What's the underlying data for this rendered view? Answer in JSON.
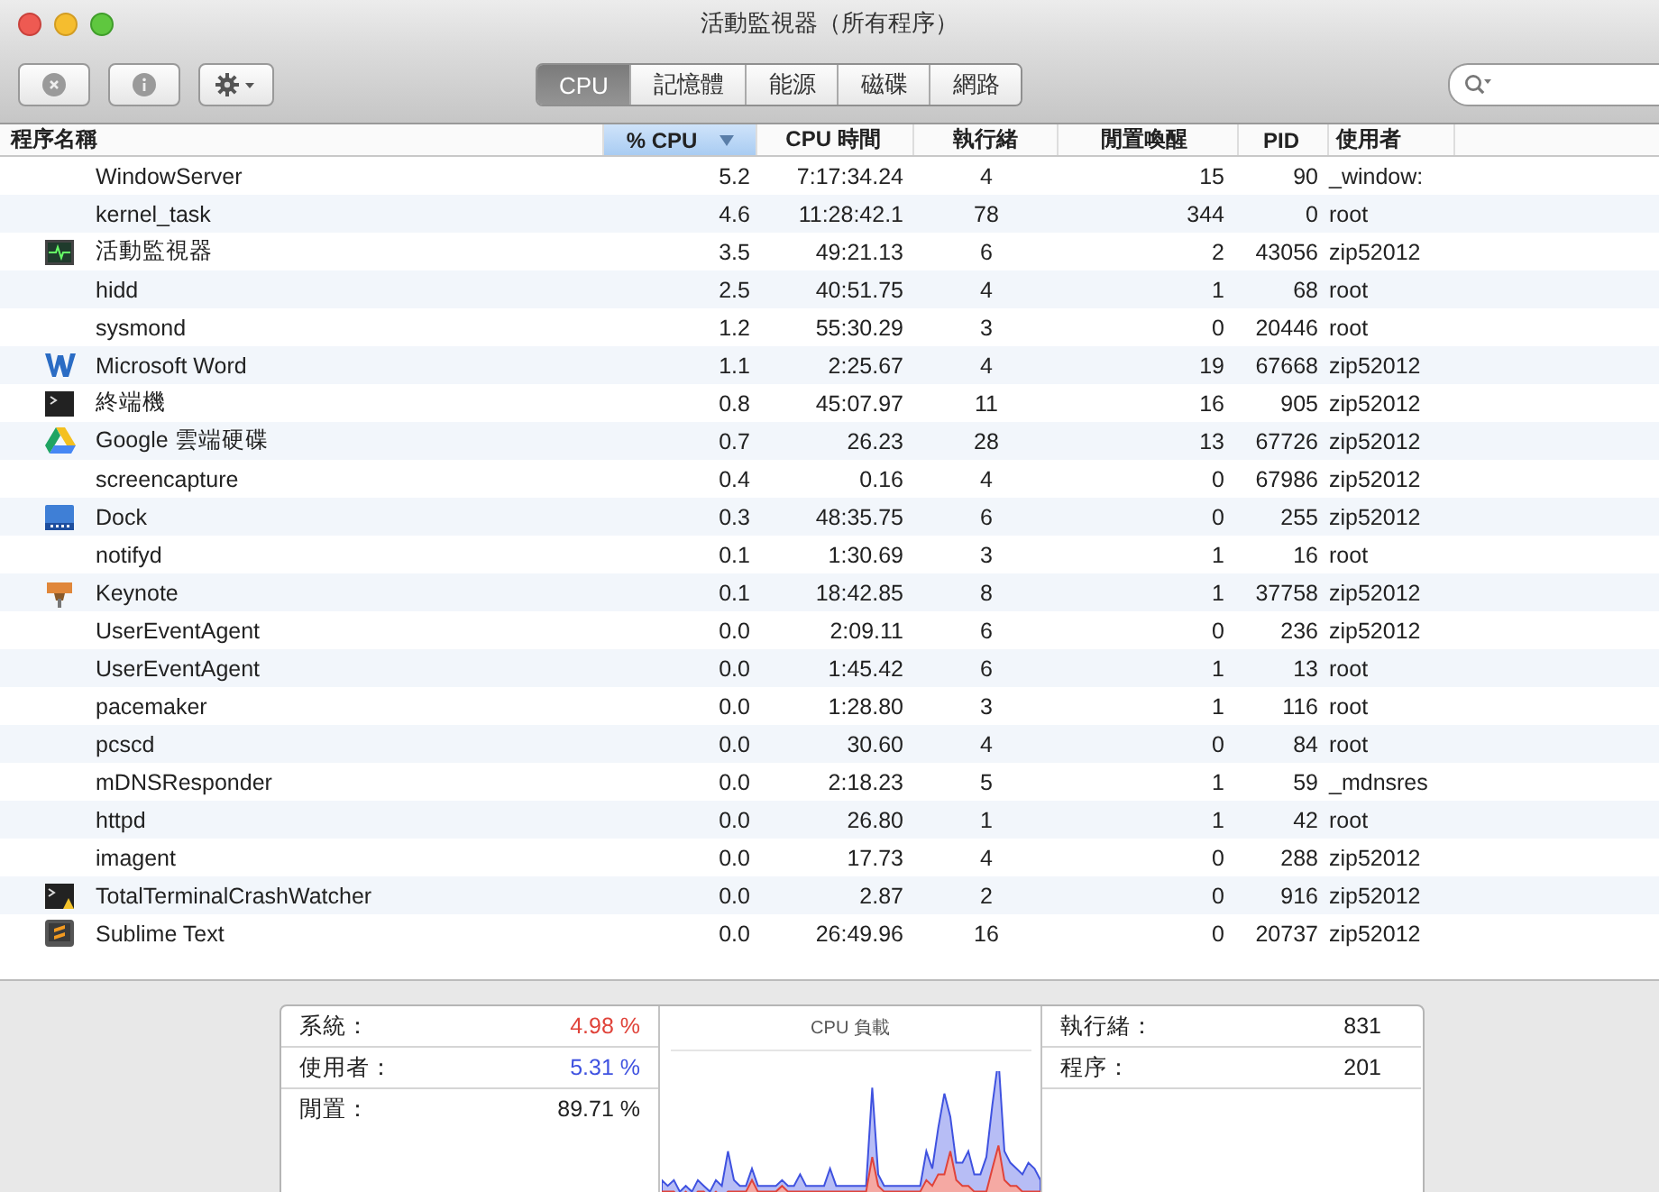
{
  "window": {
    "title": "活動監視器（所有程序）"
  },
  "toolbar": {
    "buttons": [
      {
        "kind": "stop"
      },
      {
        "kind": "info"
      },
      {
        "kind": "gear"
      }
    ],
    "tabs": [
      {
        "label": "CPU",
        "selected": true
      },
      {
        "label": "記憶體",
        "selected": false
      },
      {
        "label": "能源",
        "selected": false
      },
      {
        "label": "磁碟",
        "selected": false
      },
      {
        "label": "網路",
        "selected": false
      }
    ]
  },
  "table": {
    "columns": [
      {
        "label": "程序名稱",
        "selected": false
      },
      {
        "label": "% CPU",
        "selected": true
      },
      {
        "label": "CPU 時間",
        "selected": false
      },
      {
        "label": "執行緒",
        "selected": false
      },
      {
        "label": "閒置喚醒",
        "selected": false
      },
      {
        "label": "PID",
        "selected": false
      },
      {
        "label": "使用者",
        "selected": false
      }
    ],
    "rows": [
      {
        "kind": "plain",
        "name": "WindowServer",
        "cpu": "5.2",
        "time": "7:17:34.24",
        "threads": "4",
        "wakes": "15",
        "pid": "90",
        "user": "_window:"
      },
      {
        "kind": "plain",
        "name": "kernel_task",
        "cpu": "4.6",
        "time": "11:28:42.1",
        "threads": "78",
        "wakes": "344",
        "pid": "0",
        "user": "root"
      },
      {
        "kind": "monitor",
        "name": "活動監視器",
        "cpu": "3.5",
        "time": "49:21.13",
        "threads": "6",
        "wakes": "2",
        "pid": "43056",
        "user": "zip52012"
      },
      {
        "kind": "plain",
        "name": "hidd",
        "cpu": "2.5",
        "time": "40:51.75",
        "threads": "4",
        "wakes": "1",
        "pid": "68",
        "user": "root"
      },
      {
        "kind": "plain",
        "name": "sysmond",
        "cpu": "1.2",
        "time": "55:30.29",
        "threads": "3",
        "wakes": "0",
        "pid": "20446",
        "user": "root"
      },
      {
        "kind": "word",
        "name": "Microsoft Word",
        "cpu": "1.1",
        "time": "2:25.67",
        "threads": "4",
        "wakes": "19",
        "pid": "67668",
        "user": "zip52012"
      },
      {
        "kind": "terminal",
        "name": "終端機",
        "cpu": "0.8",
        "time": "45:07.97",
        "threads": "11",
        "wakes": "16",
        "pid": "905",
        "user": "zip52012"
      },
      {
        "kind": "drive",
        "name": "Google 雲端硬碟",
        "cpu": "0.7",
        "time": "26.23",
        "threads": "28",
        "wakes": "13",
        "pid": "67726",
        "user": "zip52012"
      },
      {
        "kind": "plain",
        "name": "screencapture",
        "cpu": "0.4",
        "time": "0.16",
        "threads": "4",
        "wakes": "0",
        "pid": "67986",
        "user": "zip52012"
      },
      {
        "kind": "dock",
        "name": "Dock",
        "cpu": "0.3",
        "time": "48:35.75",
        "threads": "6",
        "wakes": "0",
        "pid": "255",
        "user": "zip52012"
      },
      {
        "kind": "plain",
        "name": "notifyd",
        "cpu": "0.1",
        "time": "1:30.69",
        "threads": "3",
        "wakes": "1",
        "pid": "16",
        "user": "root"
      },
      {
        "kind": "keynote",
        "name": "Keynote",
        "cpu": "0.1",
        "time": "18:42.85",
        "threads": "8",
        "wakes": "1",
        "pid": "37758",
        "user": "zip52012"
      },
      {
        "kind": "plain",
        "name": "UserEventAgent",
        "cpu": "0.0",
        "time": "2:09.11",
        "threads": "6",
        "wakes": "0",
        "pid": "236",
        "user": "zip52012"
      },
      {
        "kind": "plain",
        "name": "UserEventAgent",
        "cpu": "0.0",
        "time": "1:45.42",
        "threads": "6",
        "wakes": "1",
        "pid": "13",
        "user": "root"
      },
      {
        "kind": "plain",
        "name": "pacemaker",
        "cpu": "0.0",
        "time": "1:28.80",
        "threads": "3",
        "wakes": "1",
        "pid": "116",
        "user": "root"
      },
      {
        "kind": "plain",
        "name": "pcscd",
        "cpu": "0.0",
        "time": "30.60",
        "threads": "4",
        "wakes": "0",
        "pid": "84",
        "user": "root"
      },
      {
        "kind": "plain",
        "name": "mDNSResponder",
        "cpu": "0.0",
        "time": "2:18.23",
        "threads": "5",
        "wakes": "1",
        "pid": "59",
        "user": "_mdnsres"
      },
      {
        "kind": "plain",
        "name": "httpd",
        "cpu": "0.0",
        "time": "26.80",
        "threads": "1",
        "wakes": "1",
        "pid": "42",
        "user": "root"
      },
      {
        "kind": "plain",
        "name": "imagent",
        "cpu": "0.0",
        "time": "17.73",
        "threads": "4",
        "wakes": "0",
        "pid": "288",
        "user": "zip52012"
      },
      {
        "kind": "crash",
        "name": "TotalTerminalCrashWatcher",
        "cpu": "0.0",
        "time": "2.87",
        "threads": "2",
        "wakes": "0",
        "pid": "916",
        "user": "zip52012"
      },
      {
        "kind": "sublime",
        "name": "Sublime Text",
        "cpu": "0.0",
        "time": "26:49.96",
        "threads": "16",
        "wakes": "0",
        "pid": "20737",
        "user": "zip52012"
      }
    ]
  },
  "summary": {
    "left": [
      {
        "label": "系統：",
        "value": "4.98 %",
        "color": "#e0433a"
      },
      {
        "label": "使用者：",
        "value": "5.31 %",
        "color": "#3f52e0"
      },
      {
        "label": "閒置：",
        "value": "89.71 %",
        "color": "#222222"
      }
    ],
    "chart_title": "CPU 負載",
    "right": [
      {
        "label": "執行緒：",
        "value": "831"
      },
      {
        "label": "程序：",
        "value": "201"
      }
    ]
  }
}
